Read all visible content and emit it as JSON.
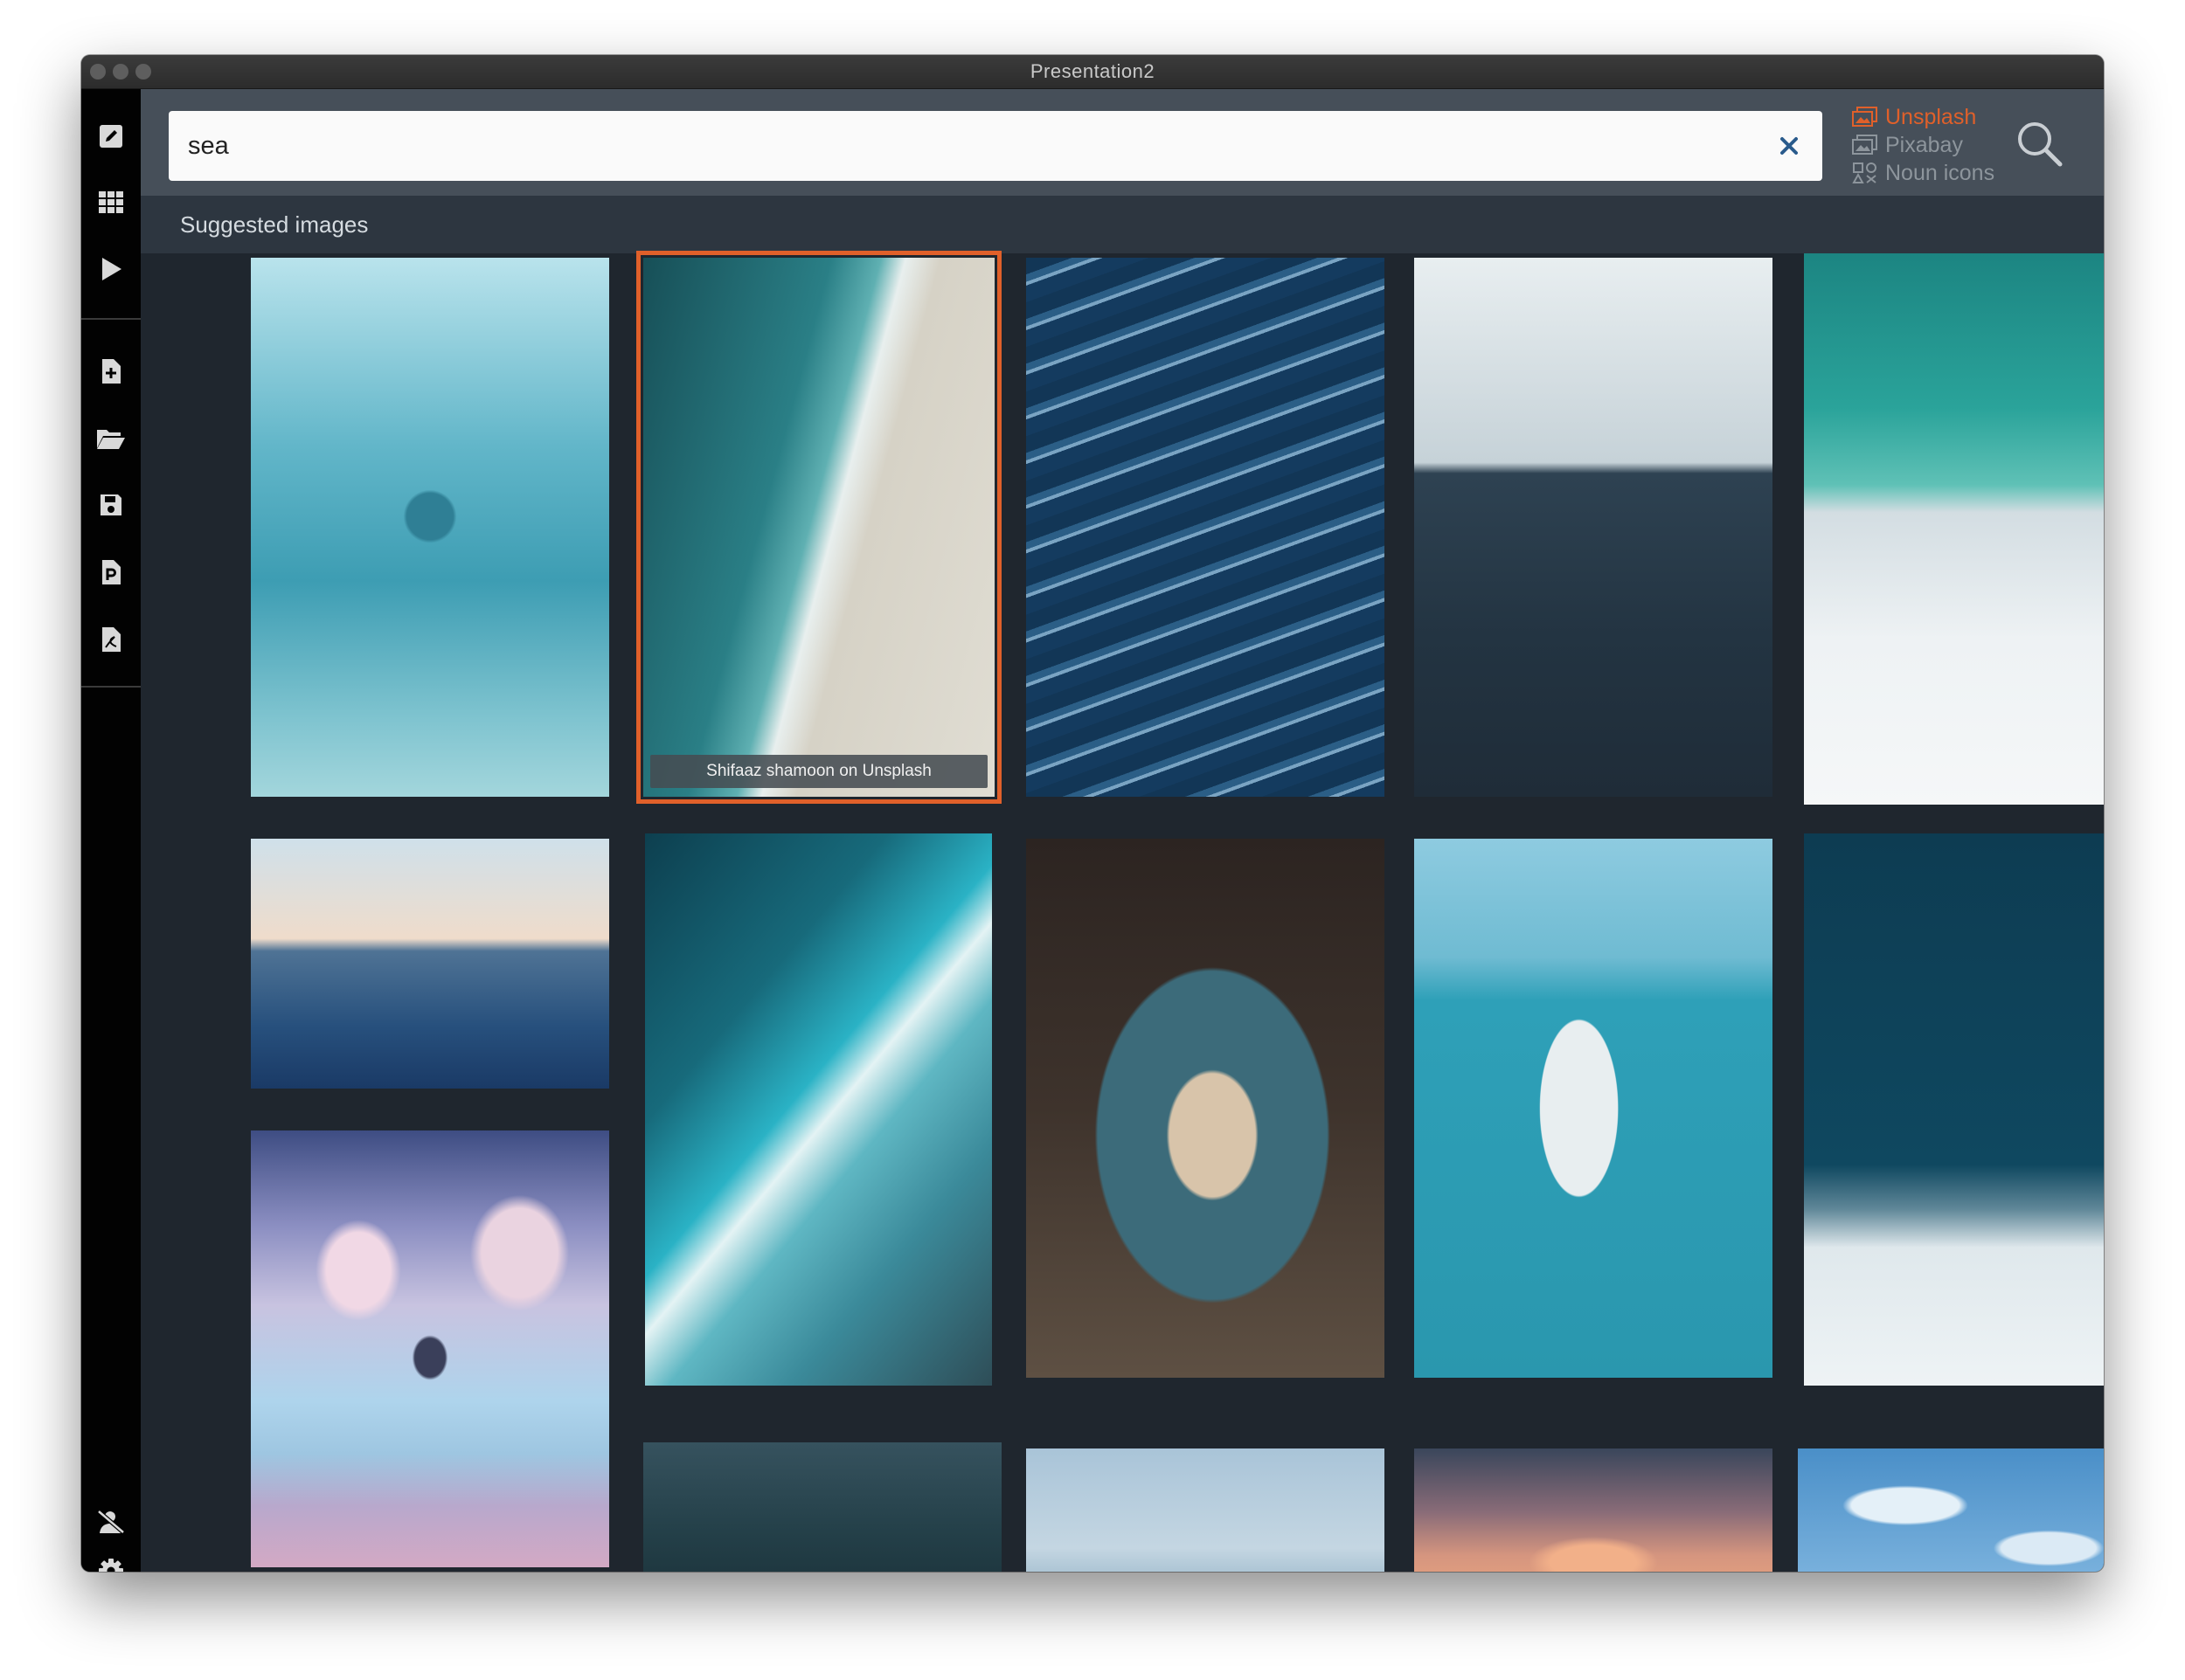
{
  "window": {
    "title": "Presentation2"
  },
  "sidebar": {
    "icons": [
      "edit-icon",
      "grid-icon",
      "play-icon",
      "new-file-icon",
      "open-folder-icon",
      "save-icon",
      "powerpoint-export-icon",
      "pdf-export-icon",
      "no-presenter-icon",
      "gear-icon"
    ]
  },
  "search": {
    "value": "sea",
    "placeholder": ""
  },
  "sources": [
    {
      "label": "Unsplash",
      "active": true,
      "color": "#e0602a"
    },
    {
      "label": "Pixabay",
      "active": false
    },
    {
      "label": "Noun icons",
      "active": false
    }
  ],
  "suggested_label": "Suggested images",
  "images": [
    {
      "subject": "diver underwater",
      "colors": [
        "#a8dbe6",
        "#4aa8bd",
        "#2f8fa6",
        "#7ac3cf"
      ]
    },
    {
      "subject": "aerial wave on beach",
      "colors": [
        "#1a5f66",
        "#2b7d82",
        "#d9d6cc"
      ],
      "caption": "Shifaaz shamoon on Unsplash",
      "selected": true
    },
    {
      "subject": "ocean waves top view",
      "colors": [
        "#0f2e4d",
        "#1d4d74",
        "#8fb4cf"
      ]
    },
    {
      "subject": "calm sea horizon with sailboat",
      "colors": [
        "#e2e9ec",
        "#b7c6cd",
        "#2b3e4f",
        "#1e2a36"
      ]
    },
    {
      "subject": "turquoise sea and white beach",
      "colors": [
        "#1d8b87",
        "#40b3a8",
        "#d6dee3",
        "#f2f5f7"
      ]
    },
    {
      "subject": "sea at sunset horizon",
      "colors": [
        "#cfe0ea",
        "#f0dccb",
        "#4c6f91",
        "#1d3f6b"
      ]
    },
    {
      "subject": "clouds over pink sea",
      "colors": [
        "#5b6a9c",
        "#c9b7d6",
        "#a8cfe8",
        "#c8a7c0"
      ]
    },
    {
      "subject": "aerial wave diagonal",
      "colors": [
        "#0f4a5a",
        "#2db3c6",
        "#d8eef0",
        "#385861"
      ]
    },
    {
      "subject": "cliffs through cave arch",
      "colors": [
        "#2a2220",
        "#d8c2a6",
        "#3f6a78",
        "#6b5a4c"
      ]
    },
    {
      "subject": "hand holding carton underwater",
      "colors": [
        "#8fcde0",
        "#2c9db6",
        "#2495ad"
      ]
    },
    {
      "subject": "deep blue sea with foam",
      "colors": [
        "#0b3c52",
        "#0e4a63",
        "#e7eef2"
      ]
    },
    {
      "subject": "dark sea surface",
      "colors": [
        "#2d4b57",
        "#1b3540"
      ]
    },
    {
      "subject": "pale sky over sea",
      "colors": [
        "#a9c3d6",
        "#c9d9e3",
        "#9ab6c8"
      ]
    },
    {
      "subject": "sunset clouds over sea",
      "colors": [
        "#2e3a4f",
        "#c98b86",
        "#e8a07e"
      ]
    },
    {
      "subject": "blue sky with clouds",
      "colors": [
        "#4f94cc",
        "#9cc6e6",
        "#e8f2f9"
      ]
    }
  ]
}
